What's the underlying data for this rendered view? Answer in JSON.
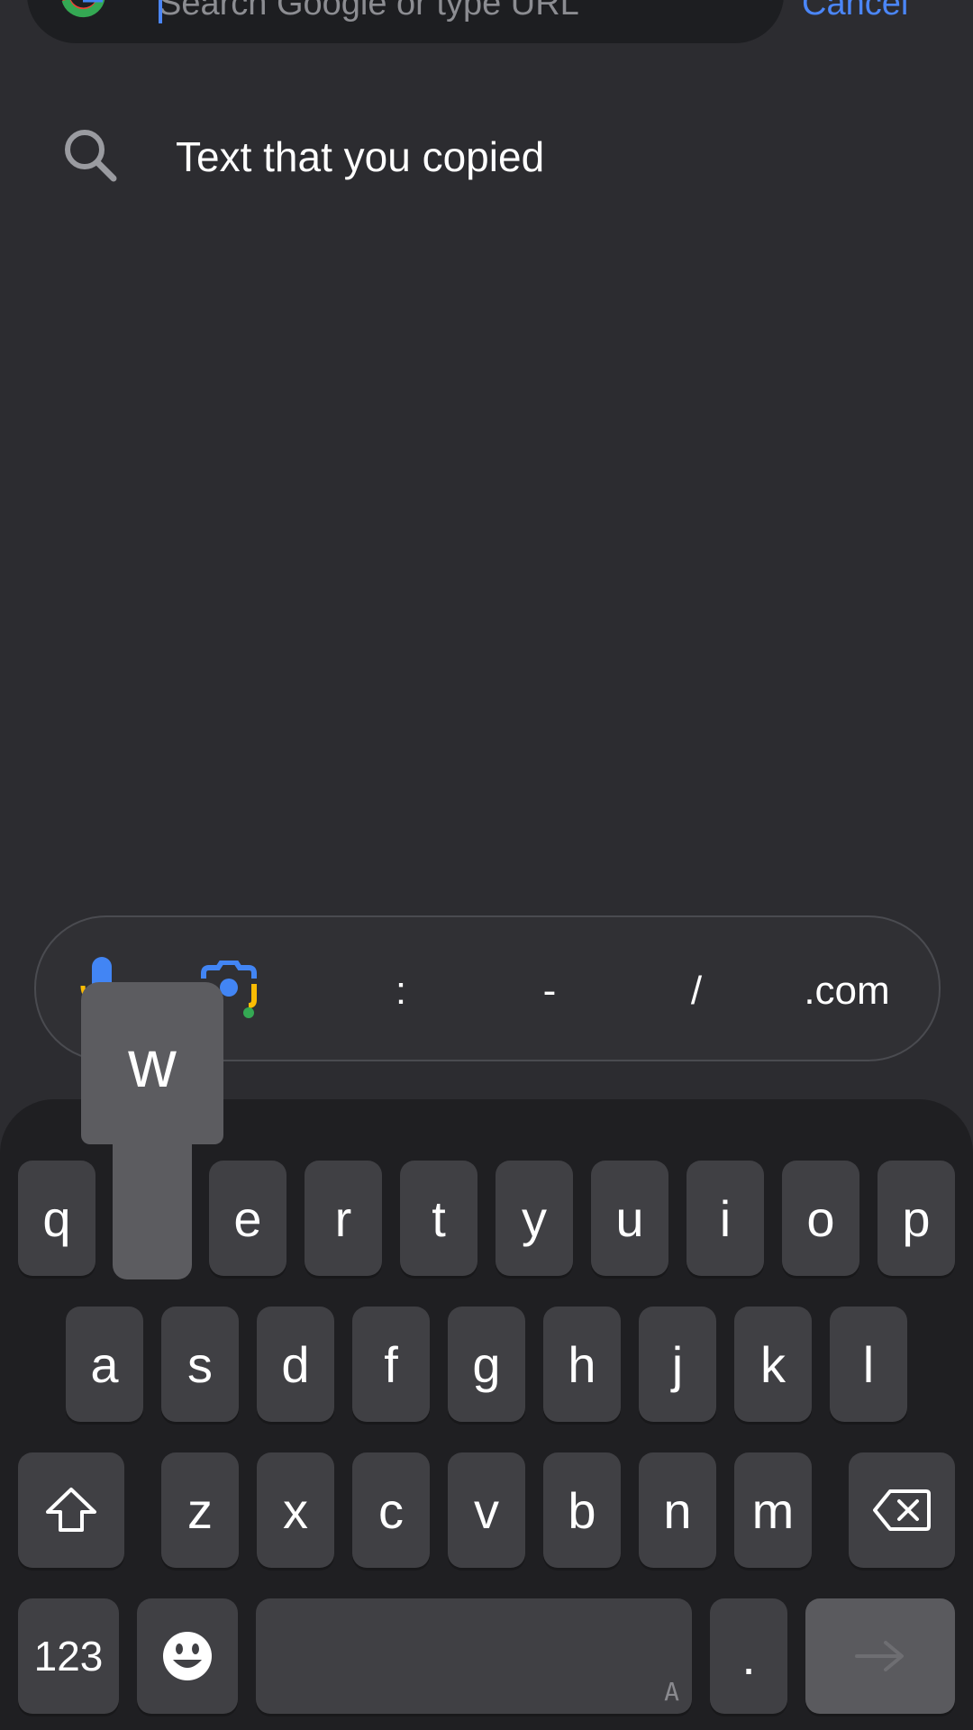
{
  "search": {
    "placeholder": "Search Google or type URL",
    "cancel_label": "Cancel"
  },
  "suggestion": {
    "text": "Text that you copied",
    "icon": "search-icon"
  },
  "shortcut_bar": {
    "icons": [
      "mic-icon",
      "lens-icon"
    ],
    "keys": [
      ":",
      "-",
      "/",
      ".com"
    ]
  },
  "keyboard": {
    "popup_letter": "w",
    "row1": [
      "q",
      "w",
      "e",
      "r",
      "t",
      "y",
      "u",
      "i",
      "o",
      "p"
    ],
    "row2": [
      "a",
      "s",
      "d",
      "f",
      "g",
      "h",
      "j",
      "k",
      "l"
    ],
    "row3": [
      "z",
      "x",
      "c",
      "v",
      "b",
      "n",
      "m"
    ],
    "numbers_label": "123",
    "period_label": ".",
    "space_hint": "A",
    "icons": [
      "shift-icon",
      "backspace-icon",
      "emoji-icon",
      "go-arrow-icon"
    ]
  },
  "colors": {
    "background": "#2c2c30",
    "accent": "#4b86f7",
    "key": "#404044",
    "keyboard": "#1f1f22"
  }
}
